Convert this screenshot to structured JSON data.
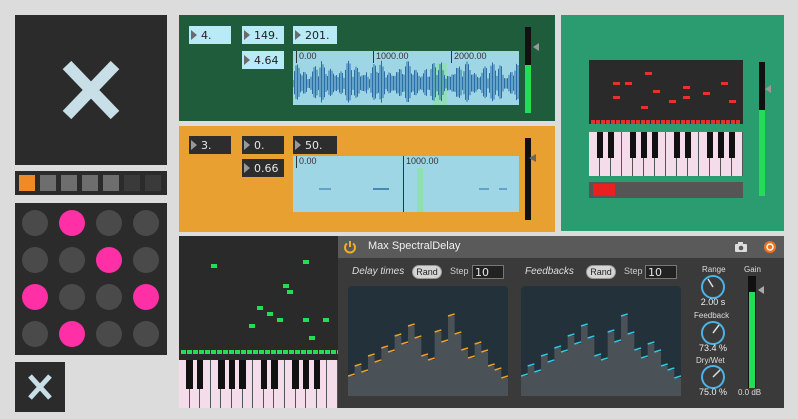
{
  "icons": {
    "big_x": "close-icon",
    "small_x": "close-icon",
    "power": "power-icon",
    "camera": "camera-icon",
    "snapshot": "snapshot-icon"
  },
  "swatches": [
    "#f08a24",
    "#6e6e6e",
    "#6e6e6e",
    "#6e6e6e",
    "#6e6e6e",
    "#3a3a3a",
    "#3a3a3a"
  ],
  "pads": [
    "off",
    "on",
    "off",
    "off",
    "off",
    "off",
    "on",
    "off",
    "on",
    "off",
    "off",
    "on",
    "off",
    "on",
    "off",
    "off"
  ],
  "colors": {
    "pad_on": "#ff2fa6",
    "pad_off": "#4a4a4a",
    "green_panel": "#1f5c3c",
    "orange_panel": "#e8a030",
    "teal_panel": "#2a9c70"
  },
  "panel_a": {
    "boxes": [
      "4.",
      "149.",
      "201.",
      "4.64"
    ],
    "ruler": [
      "0.00",
      "1000.00",
      "2000.00"
    ]
  },
  "panel_b": {
    "boxes": [
      "3.",
      "0.",
      "50.",
      "0.66"
    ],
    "ruler": [
      "0.00",
      "1000.00"
    ]
  },
  "spectral": {
    "title": "Max SpectralDelay",
    "delay_label": "Delay times",
    "feedbacks_label": "Feedbacks",
    "rand": "Rand",
    "step_label": "Step",
    "step_delay": "10",
    "step_feedback": "10",
    "range_label": "Range",
    "range_value": "2.00 s",
    "feedback_label": "Feedback",
    "feedback_value": "73.4 %",
    "drywet_label": "Dry/Wet",
    "drywet_value": "75.0 %",
    "gain_label": "Gain",
    "gain_value": "0.0 dB"
  }
}
